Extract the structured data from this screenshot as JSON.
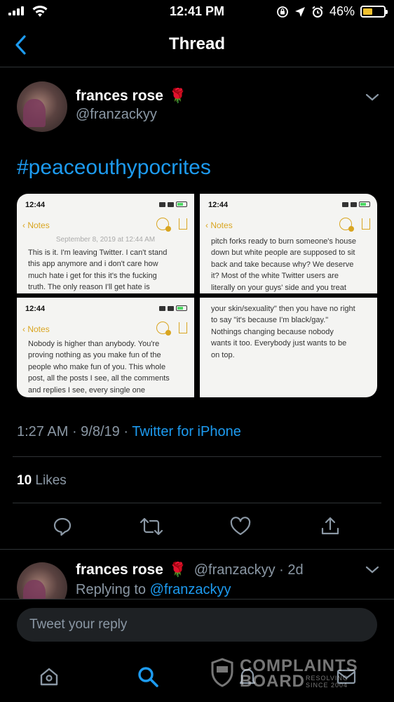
{
  "status_bar": {
    "time": "12:41 PM",
    "battery_percent": "46%",
    "battery_level": 0.46,
    "battery_color": "#f2c230"
  },
  "nav": {
    "title": "Thread",
    "back_icon": "chevron-left-icon"
  },
  "tweet": {
    "author_name": "frances rose",
    "author_emoji": "🌹",
    "handle": "@franzackyy",
    "hashtag": "#peaceouthypocrites",
    "time": "1:27 AM",
    "date": "9/8/19",
    "source": "Twitter for iPhone",
    "likes_count": "10",
    "likes_label": "Likes"
  },
  "media": [
    {
      "time": "12:44",
      "back_label": "Notes",
      "date_line": "September 8, 2019 at 12:44 AM",
      "lines": [
        "This is it. I'm leaving Twitter. I can't stand",
        "this app anymore and i don't care how",
        "much hate i get for this it's the fucking",
        "truth. The only reason I'll get hate is"
      ]
    },
    {
      "time": "12:44",
      "back_label": "Notes",
      "lines": [
        "pitch forks ready to burn someone's house",
        "down but white people are supposed to sit",
        "back and take because why? We deserve",
        "it? Most of the white Twitter users are",
        "literally on your guys' side and you treat"
      ]
    },
    {
      "time": "12:44",
      "back_label": "Notes",
      "lines": [
        "Nobody is higher than anybody. You're",
        "proving nothing as you make fun of the",
        "people who make fun of you. This whole",
        "post, all the posts I see, all the comments",
        "and replies I see, every single one"
      ]
    },
    {
      "lines": [
        "your skin/sexuality\" then you have no right",
        "to say \"it's because I'm black/gay.\"",
        "Nothings changing because nobody",
        "wants it too. Everybody just wants to be",
        "on top."
      ]
    }
  ],
  "actions": [
    "reply-icon",
    "retweet-icon",
    "like-icon",
    "share-icon"
  ],
  "reply": {
    "author_name": "frances rose",
    "author_emoji": "🌹",
    "handle_time": "@franzackyy · 2d",
    "replying_prefix": "Replying to",
    "replying_handle": "@franzackyy"
  },
  "composer": {
    "placeholder": "Tweet your reply"
  },
  "tabbar": {
    "tabs": [
      "home-icon",
      "search-icon",
      "notifications-icon",
      "messages-icon"
    ],
    "active_color": "#1d9bf0"
  },
  "watermark": {
    "line1": "COMPLAINTS",
    "line2": "BOARD",
    "tag": "RESOLVING",
    "since": "SINCE 2004"
  }
}
